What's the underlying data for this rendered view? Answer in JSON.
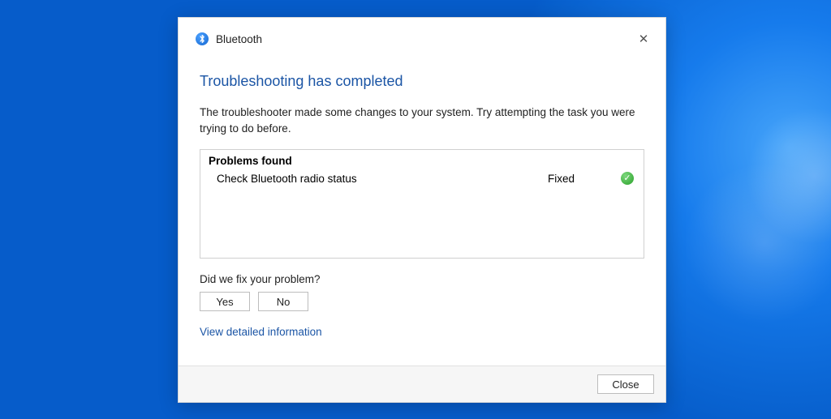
{
  "titlebar": {
    "app_name": "Bluetooth",
    "icon": "bluetooth-icon"
  },
  "headline": "Troubleshooting has completed",
  "subtext": "The troubleshooter made some changes to your system. Try attempting the task you were trying to do before.",
  "problems": {
    "header": "Problems found",
    "items": [
      {
        "name": "Check Bluetooth radio status",
        "status": "Fixed",
        "icon": "check-green"
      }
    ]
  },
  "feedback": {
    "question": "Did we fix your problem?",
    "yes": "Yes",
    "no": "No"
  },
  "detail_link": "View detailed information",
  "footer": {
    "close": "Close"
  }
}
